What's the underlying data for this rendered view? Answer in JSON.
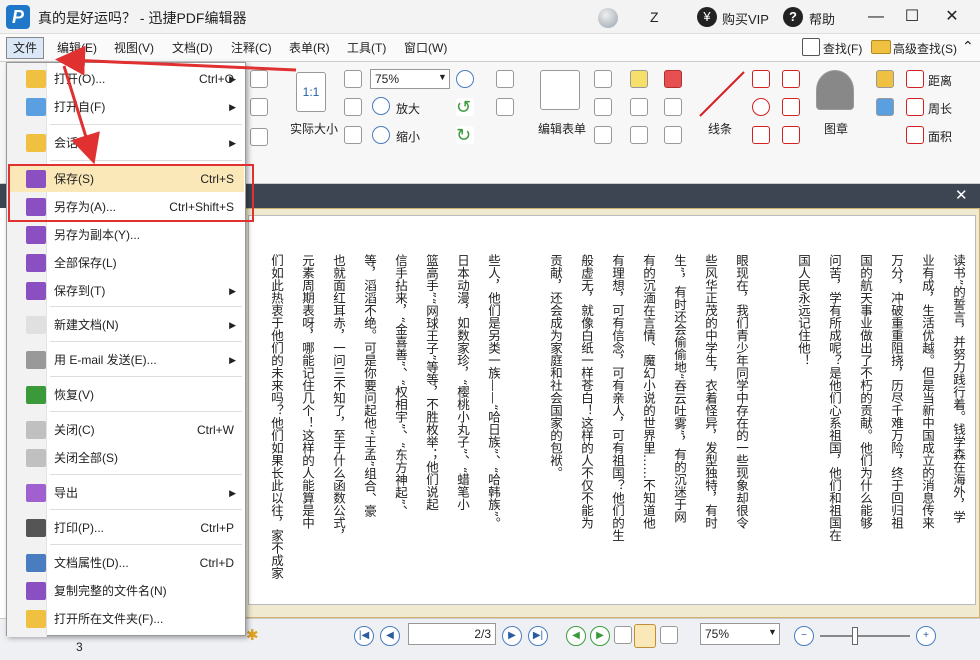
{
  "window": {
    "title": "真的是好运吗？ - 迅捷PDF编辑器",
    "z_label": "Z",
    "vip_label": "购买VIP",
    "help_label": "帮助",
    "minimize": "—",
    "maximize": "☐",
    "close": "✕"
  },
  "menubar": {
    "items": [
      "文件",
      "编辑(E)",
      "视图(V)",
      "文档(D)",
      "注释(C)",
      "表单(R)",
      "工具(T)",
      "窗口(W)"
    ],
    "find": "查找(F)",
    "advanced_find": "高级查找(S)"
  },
  "ribbon": {
    "zoom_value": "75%",
    "actual_size": "实际大小",
    "actual_size_icon": "1:1",
    "zoom_in": "放大",
    "zoom_out": "缩小",
    "edit_form": "编辑表单",
    "line": "线条",
    "stamp": "图章",
    "distance": "距离",
    "perimeter": "周长",
    "area": "面积"
  },
  "file_menu": {
    "items": [
      {
        "label": "打开(O)...",
        "shortcut": "Ctrl+O",
        "arrow": "▶",
        "icon": "open-folder-icon"
      },
      {
        "label": "打开自(F)",
        "shortcut": "",
        "arrow": "▶",
        "icon": "open-from-icon"
      },
      {
        "label": "会话",
        "shortcut": "",
        "arrow": "▶",
        "icon": "session-folder-icon"
      },
      {
        "label": "保存(S)",
        "shortcut": "Ctrl+S",
        "arrow": "",
        "icon": "save-icon"
      },
      {
        "label": "另存为(A)...",
        "shortcut": "Ctrl+Shift+S",
        "arrow": "",
        "icon": "save-as-icon"
      },
      {
        "label": "另存为副本(Y)...",
        "shortcut": "",
        "arrow": "",
        "icon": "save-copy-icon"
      },
      {
        "label": "全部保存(L)",
        "shortcut": "",
        "arrow": "",
        "icon": "save-all-icon"
      },
      {
        "label": "保存到(T)",
        "shortcut": "",
        "arrow": "▶",
        "icon": "save-to-icon"
      },
      {
        "label": "新建文档(N)",
        "shortcut": "",
        "arrow": "▶",
        "icon": "new-document-icon"
      },
      {
        "label": "用 E-mail 发送(E)...",
        "shortcut": "",
        "arrow": "▶",
        "icon": "email-icon"
      },
      {
        "label": "恢复(V)",
        "shortcut": "",
        "arrow": "",
        "icon": "restore-icon"
      },
      {
        "label": "关闭(C)",
        "shortcut": "Ctrl+W",
        "arrow": "",
        "icon": "close-document-icon"
      },
      {
        "label": "关闭全部(S)",
        "shortcut": "",
        "arrow": "",
        "icon": "close-all-icon"
      },
      {
        "label": "导出",
        "shortcut": "",
        "arrow": "▶",
        "icon": "export-icon"
      },
      {
        "label": "打印(P)...",
        "shortcut": "Ctrl+P",
        "arrow": "",
        "icon": "print-icon"
      },
      {
        "label": "文档属性(D)...",
        "shortcut": "Ctrl+D",
        "arrow": "",
        "icon": "document-properties-icon"
      },
      {
        "label": "复制完整的文件名(N)",
        "shortcut": "",
        "arrow": "",
        "icon": "copy-filename-icon"
      },
      {
        "label": "打开所在文件夹(F)...",
        "shortcut": "",
        "arrow": "",
        "icon": "open-containing-folder-icon"
      }
    ]
  },
  "document": {
    "columns": [
      "读书”的誓言，并努力践行着。钱学森在海外，学",
      "业有成，生活优越。但是当新中国成立的消息传来",
      "万分，冲破重重阻挠，历尽千难万险，终于回归祖",
      "国的航天事业做出了不朽的贡献。他们为什么能够",
      "问苦，学有所成呢？是他们心系祖国，他们和祖国在",
      "国人民永远记住他！",
      "",
      "眼现在，我们青少年同学中存在的一些现象却很令",
      "些风华正茂的中学生，衣着怪异，发型独特，有时",
      "生”，有时还会偷偷地“吞云吐雾”，有的沉迷于网",
      "有的沉湎在言情、魔幻小说的世界里……不知道他",
      "有理想，可有信念，可有亲人，可有祖国？他们的生",
      "般虚无，就像白纸一样苍白！这样的人不仅不能为",
      "贡献，还会成为家庭和社会国家的包袱。",
      "",
      "些人，他们是另类一族——“哈日族”、“哈韩族”。",
      "日本动漫，如数家珍，“樱桃小丸子”、“蜡笔小",
      "篮高手”“网球王子”等等，不胜枚举；他们说起",
      "信手拈来，“金喜善”、“权相宇”、“东方神起”、",
      "等，滔滔不绝。可是你要问起他“王孟”组合、豪",
      "也就面红耳赤，一问三不知了，至于什么函数公式，",
      "元素周期表呀，哪能记住几个！这样的人能算是中",
      "们如此热衷于他们的未来吗？他们如果长此以往，家不成家"
    ]
  },
  "statusbar": {
    "page_value": "2/3",
    "zoom_value": "75%",
    "left_value": "3",
    "nav_first": "|◀",
    "nav_prev": "◀",
    "nav_next": "▶",
    "nav_last": "▶|",
    "back": "◀",
    "forward": "▶",
    "zoom_minus": "−",
    "zoom_plus": "+"
  },
  "colors": {
    "highlight_border": "#e03030",
    "annotation_arrow": "#e03030",
    "menu_hover": "#fbe8b8",
    "dark_bar": "#3d4552"
  }
}
